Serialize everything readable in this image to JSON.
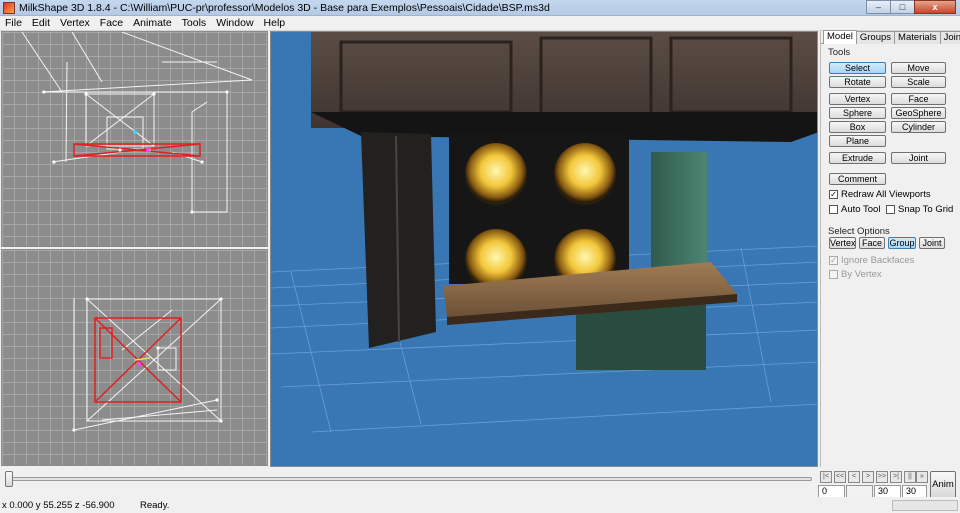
{
  "window": {
    "title": "MilkShape 3D 1.8.4 - C:\\William\\PUC-pr\\professor\\Modelos 3D - Base para Exemplos\\Pessoais\\Cidade\\BSP.ms3d",
    "min": "–",
    "max": "□",
    "close": "x"
  },
  "menu": [
    "File",
    "Edit",
    "Vertex",
    "Face",
    "Animate",
    "Tools",
    "Window",
    "Help"
  ],
  "tabs": [
    "Model",
    "Groups",
    "Materials",
    "Joints"
  ],
  "tools": {
    "label": "Tools",
    "select": "Select",
    "move": "Move",
    "rotate": "Rotate",
    "scale": "Scale",
    "vertex": "Vertex",
    "face": "Face",
    "sphere": "Sphere",
    "geosphere": "GeoSphere",
    "box": "Box",
    "cylinder": "Cylinder",
    "plane": "Plane",
    "extrude": "Extrude",
    "joint": "Joint",
    "comment": "Comment"
  },
  "checks": {
    "redraw": "Redraw All Viewports",
    "autotool": "Auto Tool",
    "snap": "Snap To Grid",
    "ignore_backfaces": "Ignore Backfaces",
    "by_vertex": "By Vertex",
    "checkmark": "✓"
  },
  "select_options": {
    "label": "Select Options",
    "vertex": "Vertex",
    "face": "Face",
    "group": "Group",
    "joint": "Joint"
  },
  "anim": {
    "controls": [
      "|<",
      "<<",
      "<",
      ">",
      ">>",
      ">|",
      "||",
      "»"
    ],
    "frame": "0",
    "start": "",
    "total": "30",
    "end": "30",
    "button": "Anim"
  },
  "status": {
    "coords": "x 0.000 y 55.255 z -56.900",
    "message": "Ready."
  },
  "colors": {
    "sky": "#3876b4",
    "selection": "#e02020",
    "wire": "#ffffff"
  }
}
